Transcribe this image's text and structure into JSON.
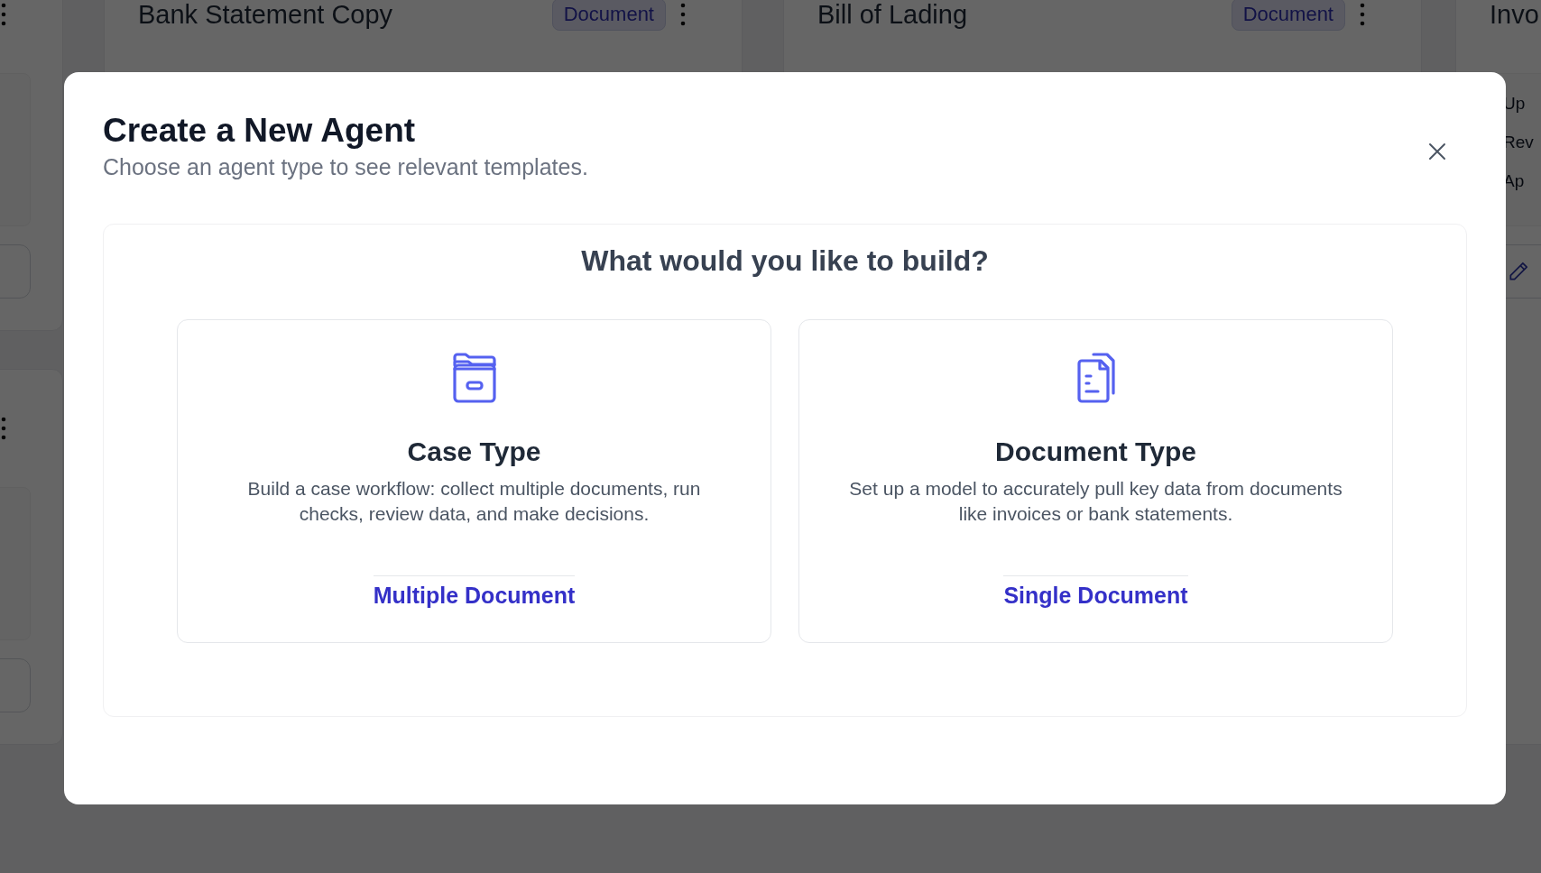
{
  "background_cards": [
    {
      "title": "Bank Statement Copy",
      "badge": "Document"
    },
    {
      "title": "Bill of Lading",
      "badge": "Document"
    },
    {
      "title": "Invo",
      "items": [
        "Up",
        "Rev",
        "Ap"
      ]
    }
  ],
  "modal": {
    "title": "Create a New Agent",
    "subtitle": "Choose an agent type to see relevant templates.",
    "heading": "What would you like to build?",
    "options": [
      {
        "kind": "folder",
        "title": "Case Type",
        "description": "Build a case workflow: collect multiple documents, run checks, review data, and make decisions.",
        "link": "Multiple Document"
      },
      {
        "kind": "document",
        "title": "Document Type",
        "description": "Set up a model to accurately pull key data from documents like invoices or bank statements.",
        "link": "Single Document"
      }
    ]
  }
}
